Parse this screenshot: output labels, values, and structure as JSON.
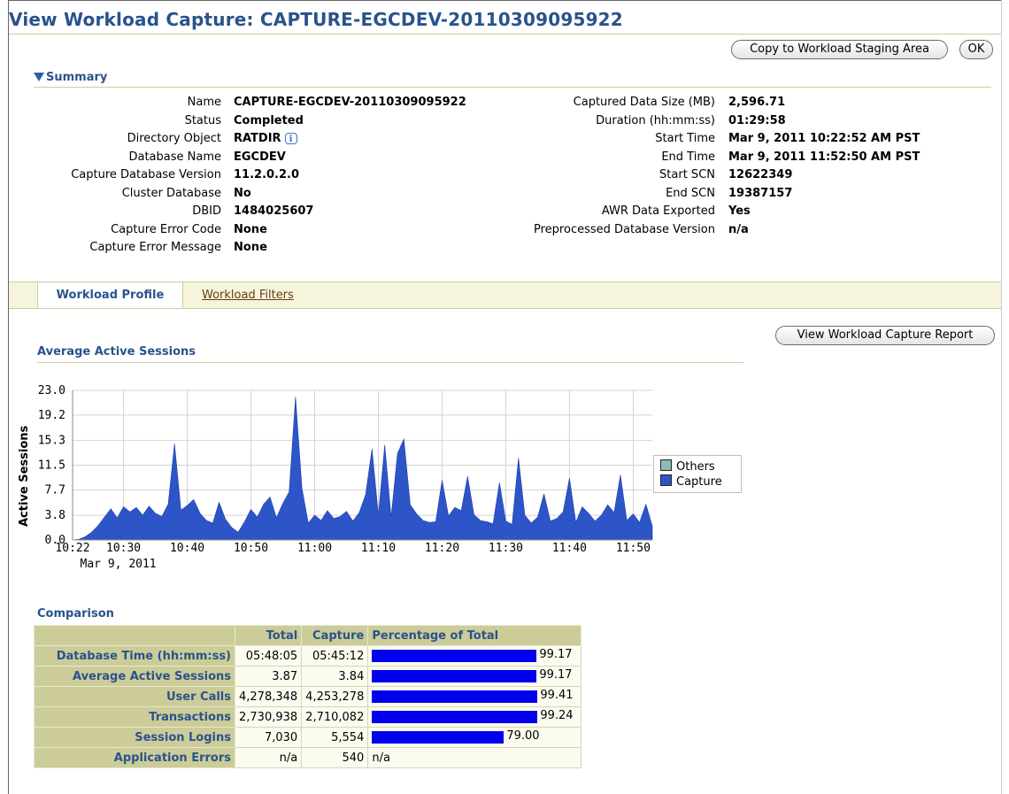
{
  "page_title": "View Workload Capture: CAPTURE-EGCDEV-20110309095922",
  "buttons": {
    "copy": "Copy to Workload Staging Area",
    "ok": "OK",
    "report": "View Workload Capture Report"
  },
  "summary": {
    "header": "Summary",
    "left": [
      {
        "label": "Name",
        "value": "CAPTURE-EGCDEV-20110309095922"
      },
      {
        "label": "Status",
        "value": "Completed"
      },
      {
        "label": "Directory Object",
        "value": "RATDIR"
      },
      {
        "label": "Database Name",
        "value": "EGCDEV"
      },
      {
        "label": "Capture Database Version",
        "value": "11.2.0.2.0"
      },
      {
        "label": "Cluster Database",
        "value": "No"
      },
      {
        "label": "DBID",
        "value": "1484025607"
      },
      {
        "label": "Capture Error Code",
        "value": "None"
      },
      {
        "label": "Capture Error Message",
        "value": "None"
      }
    ],
    "right": [
      {
        "label": "Captured Data Size (MB)",
        "value": "2,596.71"
      },
      {
        "label": "Duration (hh:mm:ss)",
        "value": "01:29:58"
      },
      {
        "label": "Start Time",
        "value": "Mar 9, 2011 10:22:52 AM PST"
      },
      {
        "label": "End Time",
        "value": "Mar 9, 2011 11:52:50 AM PST"
      },
      {
        "label": "Start SCN",
        "value": "12622349"
      },
      {
        "label": "End SCN",
        "value": "19387157"
      },
      {
        "label": "AWR Data Exported",
        "value": "Yes"
      },
      {
        "label": "Preprocessed Database Version",
        "value": "n/a"
      }
    ]
  },
  "tabs": {
    "active": "Workload Profile",
    "other": "Workload Filters"
  },
  "aas_title": "Average Active Sessions",
  "chart_data": {
    "type": "area",
    "title": "",
    "xlabel": "",
    "ylabel": "Active Sessions",
    "ylim": [
      0,
      23.0
    ],
    "ytick_labels": [
      "23.0",
      "19.2",
      "15.3",
      "11.5",
      "7.7",
      "3.8",
      "0.0"
    ],
    "xlim": [
      "10:22",
      "11:53"
    ],
    "xtick_labels": [
      "10:22",
      "10:30",
      "10:40",
      "10:50",
      "11:00",
      "11:10",
      "11:20",
      "11:30",
      "11:40",
      "11:50"
    ],
    "xdate_label": "Mar 9, 2011",
    "legend_position": "right",
    "legend": [
      {
        "name": "Others",
        "color": "#8fb8b8"
      },
      {
        "name": "Capture",
        "color": "#2d55c8"
      }
    ],
    "series": [
      {
        "name": "Others",
        "values": []
      },
      {
        "name": "Capture",
        "x": [
          "10:22",
          "10:23",
          "10:24",
          "10:25",
          "10:26",
          "10:27",
          "10:28",
          "10:29",
          "10:30",
          "10:31",
          "10:32",
          "10:33",
          "10:34",
          "10:35",
          "10:36",
          "10:37",
          "10:38",
          "10:39",
          "10:40",
          "10:41",
          "10:42",
          "10:43",
          "10:44",
          "10:45",
          "10:46",
          "10:47",
          "10:48",
          "10:49",
          "10:50",
          "10:51",
          "10:52",
          "10:53",
          "10:54",
          "10:55",
          "10:56",
          "10:57",
          "10:58",
          "10:59",
          "11:00",
          "11:01",
          "11:02",
          "11:03",
          "11:04",
          "11:05",
          "11:06",
          "11:07",
          "11:08",
          "11:09",
          "11:10",
          "11:11",
          "11:12",
          "11:13",
          "11:14",
          "11:15",
          "11:16",
          "11:17",
          "11:18",
          "11:19",
          "11:20",
          "11:21",
          "11:22",
          "11:23",
          "11:24",
          "11:25",
          "11:26",
          "11:27",
          "11:28",
          "11:29",
          "11:30",
          "11:31",
          "11:32",
          "11:33",
          "11:34",
          "11:35",
          "11:36",
          "11:37",
          "11:38",
          "11:39",
          "11:40",
          "11:41",
          "11:42",
          "11:43",
          "11:44",
          "11:45",
          "11:46",
          "11:47",
          "11:48",
          "11:49",
          "11:50",
          "11:51",
          "11:52",
          "11:53"
        ],
        "values": [
          0,
          0.1,
          0.5,
          1.2,
          2.2,
          3.5,
          4.8,
          3.4,
          5.1,
          4.3,
          5.0,
          3.8,
          5.2,
          4.1,
          3.6,
          5.5,
          14.8,
          4.6,
          5.3,
          6.2,
          4.1,
          3.0,
          2.6,
          5.8,
          3.2,
          1.9,
          1.2,
          2.8,
          4.7,
          3.5,
          5.5,
          6.6,
          3.4,
          5.6,
          7.4,
          22.0,
          8.0,
          2.6,
          3.8,
          3.0,
          4.5,
          3.3,
          3.6,
          4.4,
          2.9,
          4.2,
          7.0,
          14.0,
          3.8,
          14.6,
          3.5,
          13.3,
          15.5,
          5.4,
          4.0,
          3.0,
          2.7,
          2.8,
          9.2,
          3.7,
          5.0,
          4.5,
          9.8,
          3.9,
          3.0,
          2.8,
          2.5,
          8.8,
          2.9,
          2.4,
          12.6,
          3.8,
          2.6,
          3.5,
          7.1,
          2.9,
          3.3,
          4.3,
          9.5,
          2.7,
          5.1,
          4.1,
          2.9,
          3.8,
          5.4,
          4.2,
          10.0,
          3.0,
          4.0,
          2.7,
          5.5,
          2.1
        ]
      }
    ]
  },
  "comparison": {
    "title": "Comparison",
    "headers": [
      "",
      "Total",
      "Capture",
      "Percentage of Total"
    ],
    "rows": [
      {
        "label": "Database Time (hh:mm:ss)",
        "total": "05:48:05",
        "capture": "05:45:12",
        "pct": "99.17",
        "pct_value": 99.17
      },
      {
        "label": "Average Active Sessions",
        "total": "3.87",
        "capture": "3.84",
        "pct": "99.17",
        "pct_value": 99.17
      },
      {
        "label": "User Calls",
        "total": "4,278,348",
        "capture": "4,253,278",
        "pct": "99.41",
        "pct_value": 99.41
      },
      {
        "label": "Transactions",
        "total": "2,730,938",
        "capture": "2,710,082",
        "pct": "99.24",
        "pct_value": 99.24
      },
      {
        "label": "Session Logins",
        "total": "7,030",
        "capture": "5,554",
        "pct": "79.00",
        "pct_value": 79.0
      },
      {
        "label": "Application Errors",
        "total": "n/a",
        "capture": "540",
        "pct": "n/a",
        "pct_value": null
      }
    ]
  }
}
